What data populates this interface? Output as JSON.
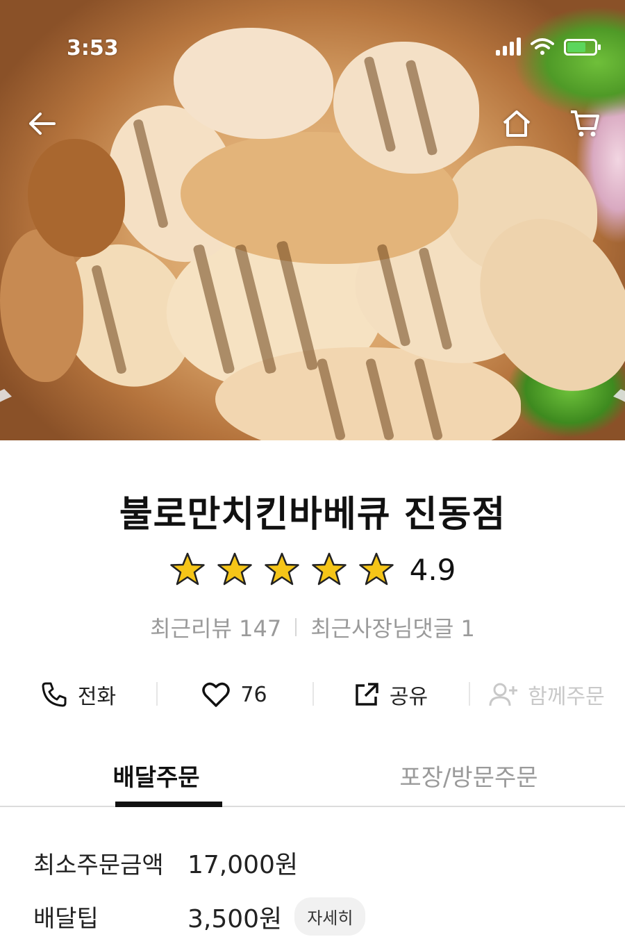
{
  "status_bar": {
    "time": "3:53"
  },
  "store": {
    "name": "불로만치킨바베큐 진동점",
    "rating": "4.9",
    "rating_stars": 5,
    "recent_reviews_label": "최근리뷰 147",
    "owner_replies_label": "최근사장님댓글 1"
  },
  "actions": {
    "call": "전화",
    "likes": "76",
    "share": "공유",
    "group_order": "함께주문"
  },
  "tabs": [
    "배달주문",
    "포장/방문주문"
  ],
  "order_info": {
    "min_order_label": "최소주문금액",
    "min_order_value": "17,000원",
    "delivery_tip_label": "배달팁",
    "delivery_tip_value": "3,500원",
    "detail_button": "자세히"
  },
  "colors": {
    "star": "#f5c518",
    "active_tab": "#111111",
    "muted": "#9a9a9a"
  }
}
